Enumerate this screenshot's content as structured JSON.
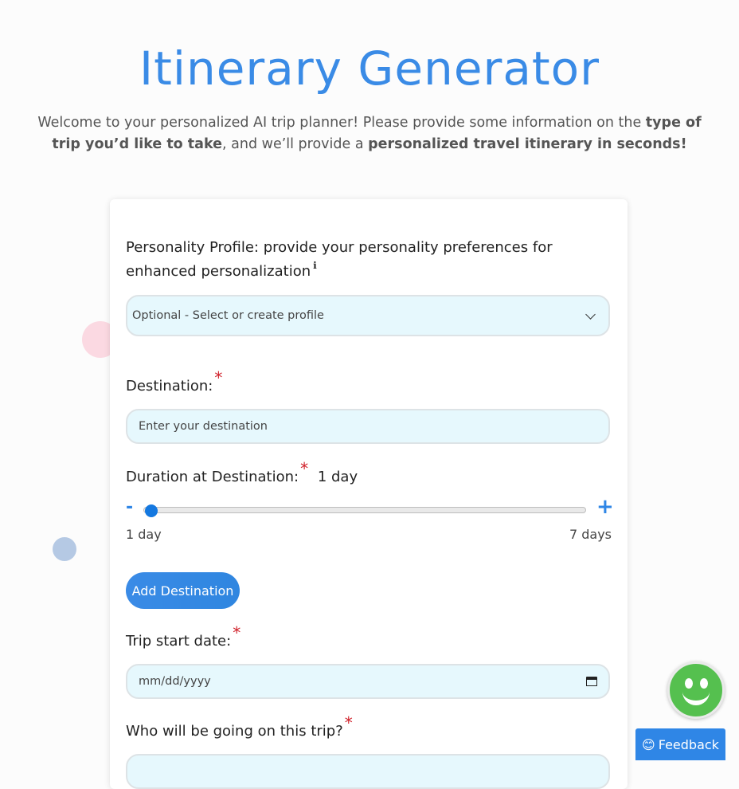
{
  "header": {
    "title": "Itinerary Generator",
    "intro_1": "Welcome to your personalized AI trip planner! Please provide some information on the ",
    "intro_bold_1": "type of trip you’d like to take",
    "intro_2": ", and we’ll provide a ",
    "intro_bold_2": "personalized travel itinerary in seconds!"
  },
  "form": {
    "personality_label": "Personality Profile: provide your personality preferences for enhanced personalization",
    "info_mark": "ℹ",
    "personality_select_value": "Optional - Select or create profile",
    "destination_label": "Destination:",
    "destination_placeholder": "Enter your destination",
    "duration_label": "Duration at Destination:",
    "duration_value": "1 day",
    "slider_min_label": "1 day",
    "slider_max_label": "7 days",
    "slider_minus": "-",
    "slider_plus": "+",
    "slider_fraction": 0.0,
    "add_destination_label": "Add Destination",
    "start_date_label": "Trip start date:",
    "start_date_placeholder": "mm/dd/yyyy",
    "travelers_label": "Who will be going on this trip?",
    "required_mark": "*"
  },
  "feedback": {
    "label": "Feedback",
    "emoji": "😊"
  },
  "colors": {
    "accent": "#3a8be6",
    "field_bg": "#e6f8fd",
    "required": "#d0202a"
  }
}
